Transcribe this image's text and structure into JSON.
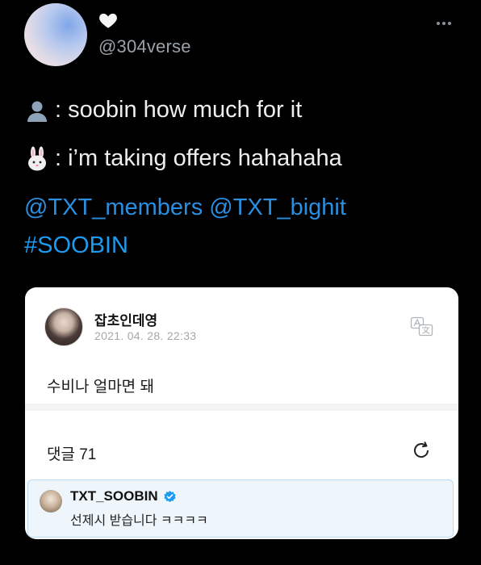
{
  "tweet": {
    "handle": "@304verse",
    "line1_text": ": soobin how much for it",
    "line2_text": ": i’m taking offers hahahaha",
    "mention1": "@TXT_members",
    "mention2": "@TXT_bighit",
    "hashtag": "#SOOBIN",
    "icons": {
      "heart": "white-heart-icon",
      "more": "more-options-icon",
      "line1": "bust-silhouette-icon",
      "line2": "rabbit-face-icon"
    }
  },
  "screenshot_card": {
    "author": "잡초인데영",
    "date": "2021. 04. 28. 22:33",
    "body": "수비나 얼마면 돼",
    "comments_label": "댓글 71",
    "icons": {
      "translate": "translate-icon",
      "refresh": "refresh-icon"
    },
    "reply": {
      "author": "TXT_SOOBIN",
      "text": "선제시 받습니다 ㅋㅋㅋㅋ",
      "verified_color": "#1d9bf0"
    }
  },
  "colors": {
    "background": "#000000",
    "link": "#1d9bf0",
    "handle": "#9aa1a8",
    "reply_bg": "#eef6fc"
  }
}
